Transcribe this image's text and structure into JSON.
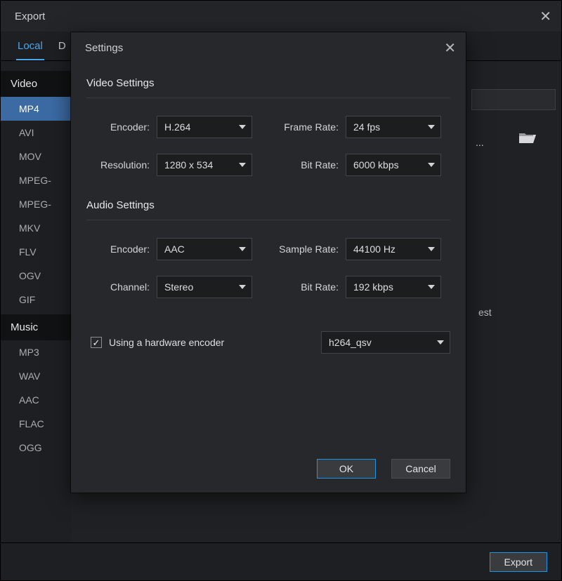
{
  "export": {
    "title": "Export",
    "tabs": {
      "local": "Local",
      "device": "D"
    },
    "sections": {
      "video": {
        "label": "Video",
        "formats": [
          "MP4",
          "AVI",
          "MOV",
          "MPEG-",
          "MPEG-",
          "MKV",
          "FLV",
          "OGV",
          "GIF"
        ],
        "selected": "MP4"
      },
      "music": {
        "label": "Music",
        "formats": [
          "MP3",
          "WAV",
          "AAC",
          "FLAC",
          "OGG"
        ]
      }
    },
    "browse_ellipsis": "...",
    "estimate_fragment": "est",
    "footer": {
      "export_btn": "Export"
    }
  },
  "modal": {
    "title": "Settings",
    "video": {
      "heading": "Video Settings",
      "encoder_label": "Encoder:",
      "encoder_value": "H.264",
      "resolution_label": "Resolution:",
      "resolution_value": "1280 x 534",
      "framerate_label": "Frame Rate:",
      "framerate_value": "24 fps",
      "bitrate_label": "Bit Rate:",
      "bitrate_value": "6000 kbps"
    },
    "audio": {
      "heading": "Audio Settings",
      "encoder_label": "Encoder:",
      "encoder_value": "AAC",
      "channel_label": "Channel:",
      "channel_value": "Stereo",
      "samplerate_label": "Sample Rate:",
      "samplerate_value": "44100 Hz",
      "bitrate_label": "Bit Rate:",
      "bitrate_value": "192 kbps"
    },
    "hw": {
      "checked": true,
      "label": "Using a hardware encoder",
      "value": "h264_qsv"
    },
    "footer": {
      "ok": "OK",
      "cancel": "Cancel"
    }
  }
}
